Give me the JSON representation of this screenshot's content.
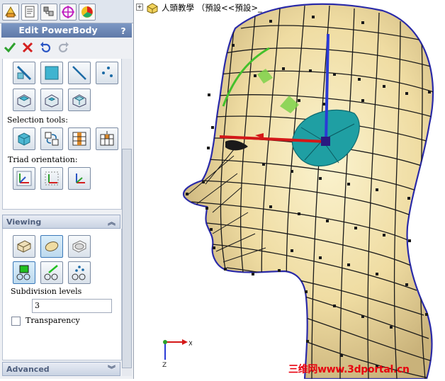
{
  "propertymanager": {
    "title": "Edit PowerBody",
    "help_label": "?",
    "actions": [
      "ok-icon",
      "cancel-icon",
      "undo-icon",
      "redo-icon"
    ],
    "tabs": [
      "feature-manager-icon",
      "property-manager-icon",
      "configuration-manager-icon",
      "dimxpert-icon",
      "display-manager-icon"
    ],
    "selection_tools_label": "Selection tools:",
    "triad_orientation_label": "Triad orientation:",
    "viewing": {
      "header": "Viewing",
      "subdivision_label": "Subdivision levels",
      "subdivision_value": "3",
      "transparency_label": "Transparency",
      "transparency_checked": false
    },
    "advanced": {
      "header": "Advanced"
    }
  },
  "tree": {
    "expand_label": "+",
    "root_label": "人頭教學 （預設<<預設>_"
  },
  "triad": {
    "axis_x": "X",
    "axis_y": "Y",
    "axis_z": "Z"
  },
  "watermark": "三维网www.3dportal.cn",
  "colors": {
    "skin": "#f1e3b0",
    "mesh": "#1f1f1f",
    "accent": "#1e9a9e",
    "brand_red": "#e8000f",
    "header_blue": "#6d88b8"
  }
}
